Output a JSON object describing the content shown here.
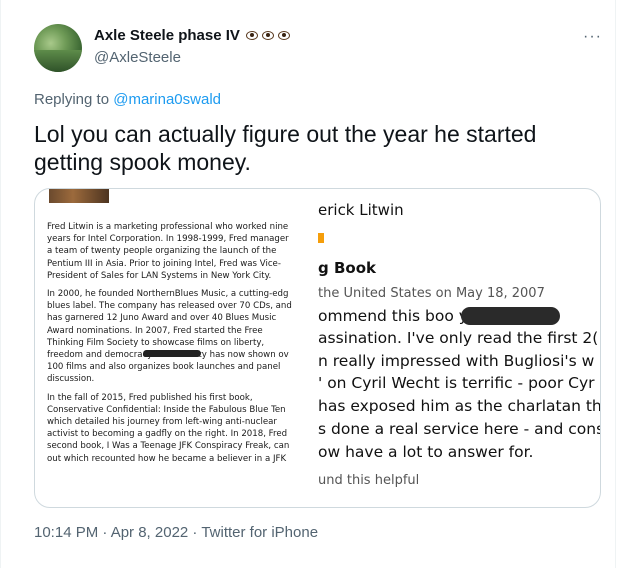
{
  "tweet": {
    "author_name": "Axle Steele phase IV",
    "author_handle": "@AxleSteele",
    "more_label": "···",
    "replying_prefix": "Replying to",
    "replying_handle": "@marina0swald",
    "text": "Lol you can actually figure out the year he started getting spook money.",
    "timestamp": "10:14 PM · Apr 8, 2022 · Twitter for iPhone"
  },
  "image_left": {
    "paragraphs": [
      [
        "Fred Litwin is a marketing professional who worked nine",
        "years for Intel Corporation. In 1998-1999, Fred manager",
        "a team of twenty people organizing the launch of the",
        "Pentium III in Asia. Prior to joining Intel, Fred was Vice-",
        "President of Sales for LAN Systems in New York City."
      ],
      [
        "In 2000, he founded NorthernBlues Music, a cutting-edg",
        "blues label. The company has released over 70 CDs, and",
        "has garnered 12 Juno Award and over 40 Blues Music",
        "Award nominations. In 2007, Fred started the Free",
        "Thinking Film Society to showcase films on liberty,",
        "freedom and democracy. The Society has now shown ov",
        "100 films and also organizes book launches and panel",
        "discussion."
      ],
      [
        "In the fall of 2015, Fred published his first book,",
        "Conservative Confidential: Inside the Fabulous Blue Ten",
        "which detailed his journey from left-wing anti-nuclear",
        "activist to becoming a gadfly on the right. In 2018, Fred",
        "second book, I Was a Teenage JFK Conspiracy Freak, can",
        "out which recounted how he became a believer in a JFK"
      ]
    ]
  },
  "image_right": {
    "author": "erick Litwin",
    "title": "g Book",
    "meta": "the United States on May 18, 2007",
    "body_lines": [
      "ommend this boo             y inte",
      "assination. I've only read the first 2(",
      "n really impressed with Bugliosi's w",
      "' on Cyril Wecht is terrific - poor Cyr",
      "has exposed him as the charlatan th",
      "s done a real service here - and cons",
      "ow have a lot to answer for."
    ],
    "helpful": "und this helpful"
  }
}
